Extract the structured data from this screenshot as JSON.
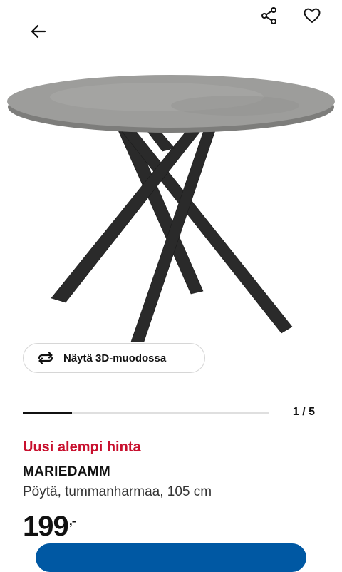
{
  "header": {
    "back_icon": "arrow-left-icon",
    "share_icon": "share-icon",
    "favourite_icon": "heart-outline-icon"
  },
  "gallery": {
    "view_3d_label": "Näytä 3D-muodossa",
    "view_3d_icon": "rotate-3d-icon",
    "counter": "1 / 5",
    "current": 1,
    "total": 5
  },
  "product": {
    "promo": "Uusi alempi hinta",
    "name": "MARIEDAMM",
    "description": "Pöytä, tummanharmaa, 105 cm",
    "price_main": "199",
    "price_decimal": ",-"
  },
  "colors": {
    "promo": "#c8102e",
    "cta": "#0058a3",
    "legs": "#2a2a2a",
    "tabletop": "#9b9b99"
  }
}
